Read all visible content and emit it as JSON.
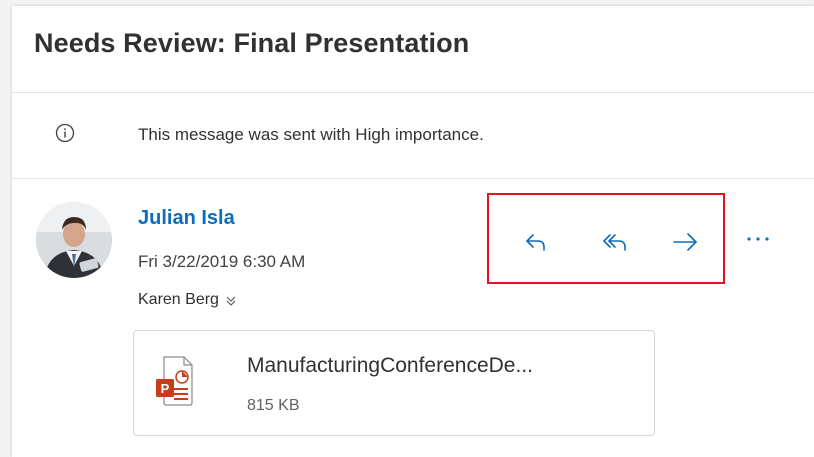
{
  "message": {
    "subject": "Needs Review: Final Presentation",
    "importance_notice": "This message was sent with High importance.",
    "sender_name": "Julian Isla",
    "datetime": "Fri 3/22/2019 6:30 AM",
    "recipient": "Karen Berg"
  },
  "actions": {
    "reply": "reply-icon",
    "reply_all": "reply-all-icon",
    "forward": "forward-icon",
    "more": "more-icon"
  },
  "attachment": {
    "name": "ManufacturingConferenceDe...",
    "size": "815 KB",
    "type_icon": "powerpoint-icon"
  },
  "colors": {
    "accent": "#0f6cbd",
    "highlight_box": "#e81123",
    "powerpoint": "#c43e1c"
  }
}
